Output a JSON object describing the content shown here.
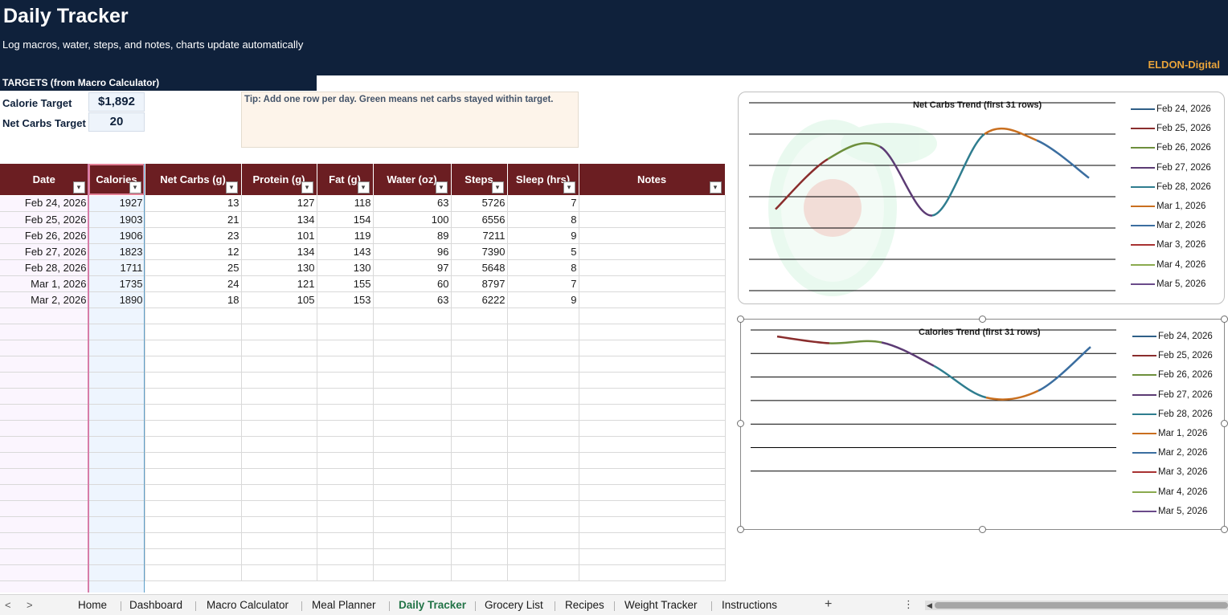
{
  "header": {
    "title": "Daily Tracker",
    "subtitle": "Log macros, water, steps, and notes, charts update automatically",
    "brand": "ELDON-Digital"
  },
  "targets": {
    "heading": "TARGETS (from Macro Calculator)",
    "calorie_label": "Calorie Target",
    "calorie_value": "$1,892",
    "carbs_label": "Net Carbs Target",
    "carbs_value": "20",
    "tip": "Tip: Add one row per day. Green means net carbs stayed within target."
  },
  "table": {
    "columns": [
      "Date",
      "Calories",
      "Net Carbs (g)",
      "Protein (g)",
      "Fat (g)",
      "Water (oz)",
      "Steps",
      "Sleep (hrs)",
      "Notes"
    ],
    "rows": [
      [
        "Feb 24, 2026",
        "1927",
        "13",
        "127",
        "118",
        "63",
        "5726",
        "7",
        ""
      ],
      [
        "Feb 25, 2026",
        "1903",
        "21",
        "134",
        "154",
        "100",
        "6556",
        "8",
        ""
      ],
      [
        "Feb 26, 2026",
        "1906",
        "23",
        "101",
        "119",
        "89",
        "7211",
        "9",
        ""
      ],
      [
        "Feb 27, 2026",
        "1823",
        "12",
        "134",
        "143",
        "96",
        "7390",
        "5",
        ""
      ],
      [
        "Feb 28, 2026",
        "1711",
        "25",
        "130",
        "130",
        "97",
        "5648",
        "8",
        ""
      ],
      [
        "Mar 1, 2026",
        "1735",
        "24",
        "121",
        "155",
        "60",
        "8797",
        "7",
        ""
      ],
      [
        "Mar 2, 2026",
        "1890",
        "18",
        "105",
        "153",
        "63",
        "6222",
        "9",
        ""
      ]
    ]
  },
  "chart_data": [
    {
      "type": "line",
      "title": "Net Carbs Trend (first 31 rows)",
      "x": [
        "Feb 24, 2026",
        "Feb 25, 2026",
        "Feb 26, 2026",
        "Feb 27, 2026",
        "Feb 28, 2026",
        "Mar 1, 2026",
        "Mar 2, 2026"
      ],
      "values": [
        13,
        21,
        23,
        12,
        25,
        24,
        18
      ],
      "ylim": [
        0,
        30
      ],
      "grid": true,
      "legend_position": "right",
      "legend": [
        "Feb 24, 2026",
        "Feb 25, 2026",
        "Feb 26, 2026",
        "Feb 27, 2026",
        "Feb 28, 2026",
        "Mar 1, 2026",
        "Mar 2, 2026",
        "Mar 3, 2026",
        "Mar 4, 2026",
        "Mar 5, 2026"
      ],
      "colors": [
        "#2f5f87",
        "#8a2d2d",
        "#6d8f3c",
        "#5c3b74",
        "#2f7d8f",
        "#c96f1f",
        "#3b6ea0",
        "#a83232",
        "#8aaa4e",
        "#6a4a8a"
      ]
    },
    {
      "type": "line",
      "title": "Calories Trend (first 31 rows)",
      "x": [
        "Feb 24, 2026",
        "Feb 25, 2026",
        "Feb 26, 2026",
        "Feb 27, 2026",
        "Feb 28, 2026",
        "Mar 1, 2026",
        "Mar 2, 2026"
      ],
      "values": [
        1927,
        1903,
        1906,
        1823,
        1711,
        1735,
        1890
      ],
      "ylim": [
        1450,
        1950
      ],
      "grid": true,
      "legend_position": "right",
      "legend": [
        "Feb 24, 2026",
        "Feb 25, 2026",
        "Feb 26, 2026",
        "Feb 27, 2026",
        "Feb 28, 2026",
        "Mar 1, 2026",
        "Mar 2, 2026",
        "Mar 3, 2026",
        "Mar 4, 2026",
        "Mar 5, 2026"
      ],
      "colors": [
        "#2f5f87",
        "#8a2d2d",
        "#6d8f3c",
        "#5c3b74",
        "#2f7d8f",
        "#c96f1f",
        "#3b6ea0",
        "#a83232",
        "#8aaa4e",
        "#6a4a8a"
      ]
    }
  ],
  "tabs": {
    "items": [
      "Home",
      "Dashboard",
      "Macro Calculator",
      "Meal Planner",
      "Daily Tracker",
      "Grocery List",
      "Recipes",
      "Weight Tracker",
      "Instructions"
    ],
    "active": "Daily Tracker",
    "add_icon": "plus-icon",
    "more_icon": "more-vertical-icon"
  }
}
